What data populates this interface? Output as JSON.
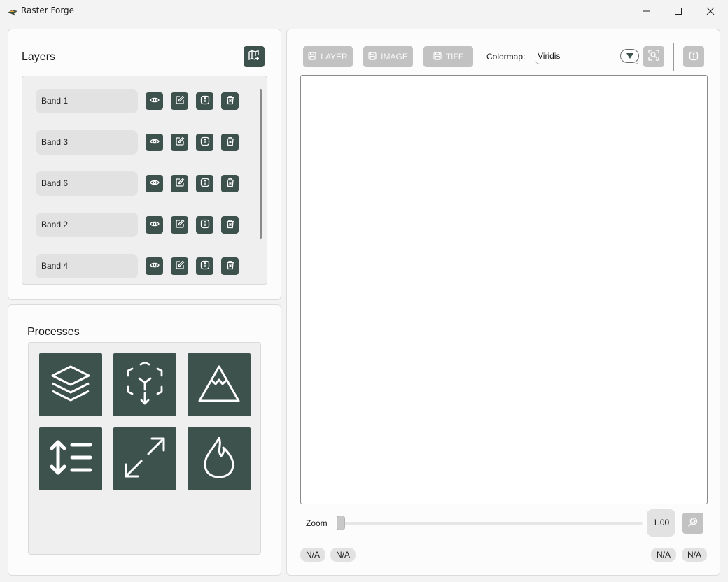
{
  "app": {
    "title": "Raster Forge"
  },
  "layers": {
    "title": "Layers",
    "items": [
      {
        "label": "Band 1"
      },
      {
        "label": "Band 3"
      },
      {
        "label": "Band 6"
      },
      {
        "label": "Band 2"
      },
      {
        "label": "Band 4"
      }
    ]
  },
  "processes": {
    "title": "Processes",
    "tiles": [
      "layers-icon",
      "cube-3d-icon",
      "mountain-icon",
      "sort-lines-icon",
      "expand-diagonal-icon",
      "flame-icon"
    ]
  },
  "toolbar": {
    "save_layer": "LAYER",
    "save_image": "IMAGE",
    "save_tiff": "TIFF",
    "colormap_label": "Colormap:",
    "colormap_value": "Viridis"
  },
  "zoom": {
    "label": "Zoom",
    "value": "1.00",
    "level": 0.0
  },
  "status": {
    "left": [
      "N/A",
      "N/A"
    ],
    "right": [
      "N/A",
      "N/A"
    ]
  },
  "colors": {
    "accent": "#3e524d",
    "disabled": "#c2c2c2"
  }
}
